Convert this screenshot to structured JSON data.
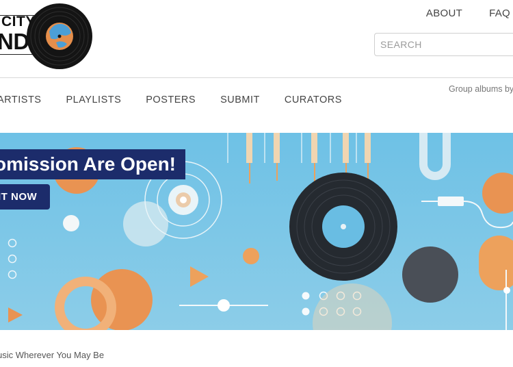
{
  "logo": {
    "line1": "CITY",
    "line2": "NDS",
    "icon": "vinyl-record-icon"
  },
  "top_links": [
    {
      "label": "ABOUT"
    },
    {
      "label": "FAQ"
    }
  ],
  "search": {
    "placeholder": "SEARCH",
    "value": ""
  },
  "nav": [
    {
      "label": "ARTISTS"
    },
    {
      "label": "PLAYLISTS"
    },
    {
      "label": "POSTERS"
    },
    {
      "label": "SUBMIT"
    },
    {
      "label": "CURATORS"
    }
  ],
  "tagline": "Group albums by",
  "banner": {
    "title": "omission Are Open!",
    "button_label": "IT NOW",
    "colors": {
      "background": "#7cc6e6",
      "label_bg": "#1c2c6b",
      "orange": "#eda15c",
      "dark": "#2a2d33"
    }
  },
  "subtitle": "usic Wherever You May Be"
}
